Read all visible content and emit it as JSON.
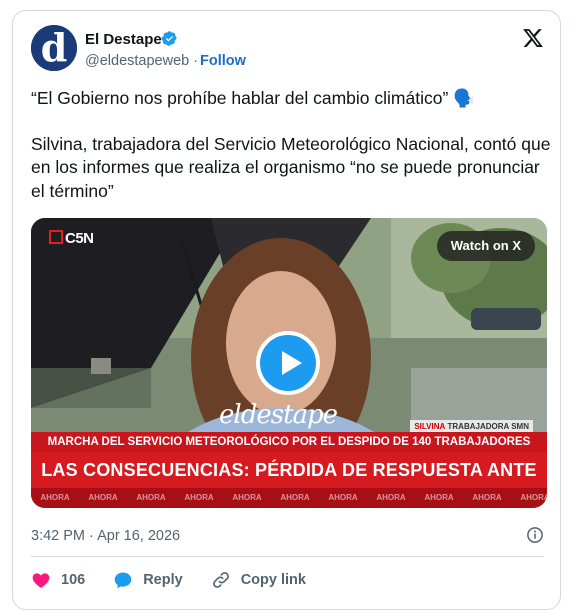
{
  "author": {
    "name": "El Destape",
    "handle": "@eldestapeweb",
    "separator": "·",
    "follow_label": "Follow",
    "avatar_letter": "d"
  },
  "tweet": {
    "line1": "“El Gobierno nos prohíbe hablar del cambio climático” 🗣️",
    "line2": "Silvina, trabajadora del Servicio Meteorológico Nacional, contó que en los informes que realiza el organismo “no se puede pronunciar el término”"
  },
  "media": {
    "channel": "C5N",
    "watch_label": "Watch on X",
    "watermark": "eldestape",
    "name_tag": "SILVINA",
    "name_tag_role": "TRABAJADORA SMN",
    "headline_small": "MARCHA DEL SERVICIO METEOROLÓGICO POR EL DESPIDO DE 140 TRABAJADORES",
    "headline_big": "LAS CONSECUENCIAS: PÉRDIDA DE RESPUESTA ANTE FENÓMENOS",
    "ticker": [
      "AHORA",
      "AHORA",
      "AHORA",
      "AHORA",
      "AHORA",
      "AHORA",
      "AHORA",
      "AHORA",
      "AHORA",
      "AHORA",
      "AHORA"
    ]
  },
  "meta": {
    "timestamp": "3:42 PM · Apr 16, 2026"
  },
  "actions": {
    "likes": "106",
    "reply_label": "Reply",
    "copy_label": "Copy link"
  },
  "colors": {
    "accent": "#1d9bf0",
    "follow": "#1d6fc4",
    "like": "#f91880",
    "banner_red": "#d71920"
  }
}
